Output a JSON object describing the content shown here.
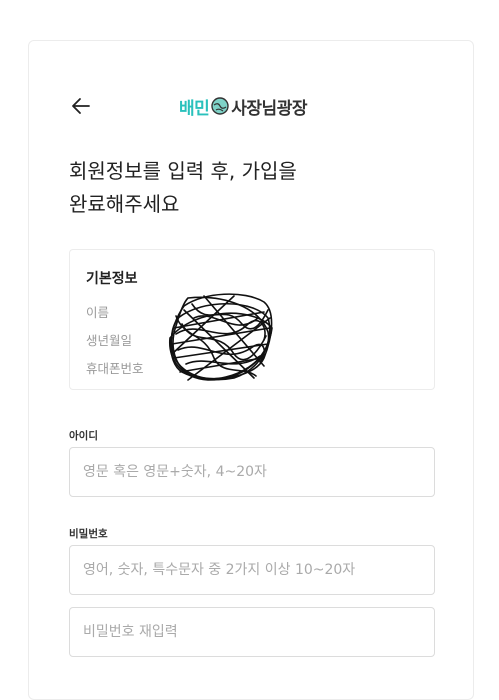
{
  "header": {
    "back_icon": "arrow-left-icon",
    "logo_brand": "배민",
    "logo_rest": "사장님광장",
    "logo_mark_icon": "globe-hands-icon",
    "brand_color": "#2ac1bc"
  },
  "title": {
    "line1": "회원정보를 입력 후, 가입을",
    "line2": "완료해주세요"
  },
  "basic_info": {
    "heading": "기본정보",
    "name_label": "이름",
    "birth_label": "생년월일",
    "phone_label": "휴대폰번호"
  },
  "id_field": {
    "label": "아이디",
    "value": "",
    "placeholder": "영문 혹은 영문+숫자, 4~20자"
  },
  "password_field": {
    "label": "비밀번호",
    "value": "",
    "placeholder": "영어, 숫자, 특수문자 중 2가지 이상 10~20자"
  },
  "password_confirm_field": {
    "value": "",
    "placeholder": "비밀번호 재입력"
  }
}
